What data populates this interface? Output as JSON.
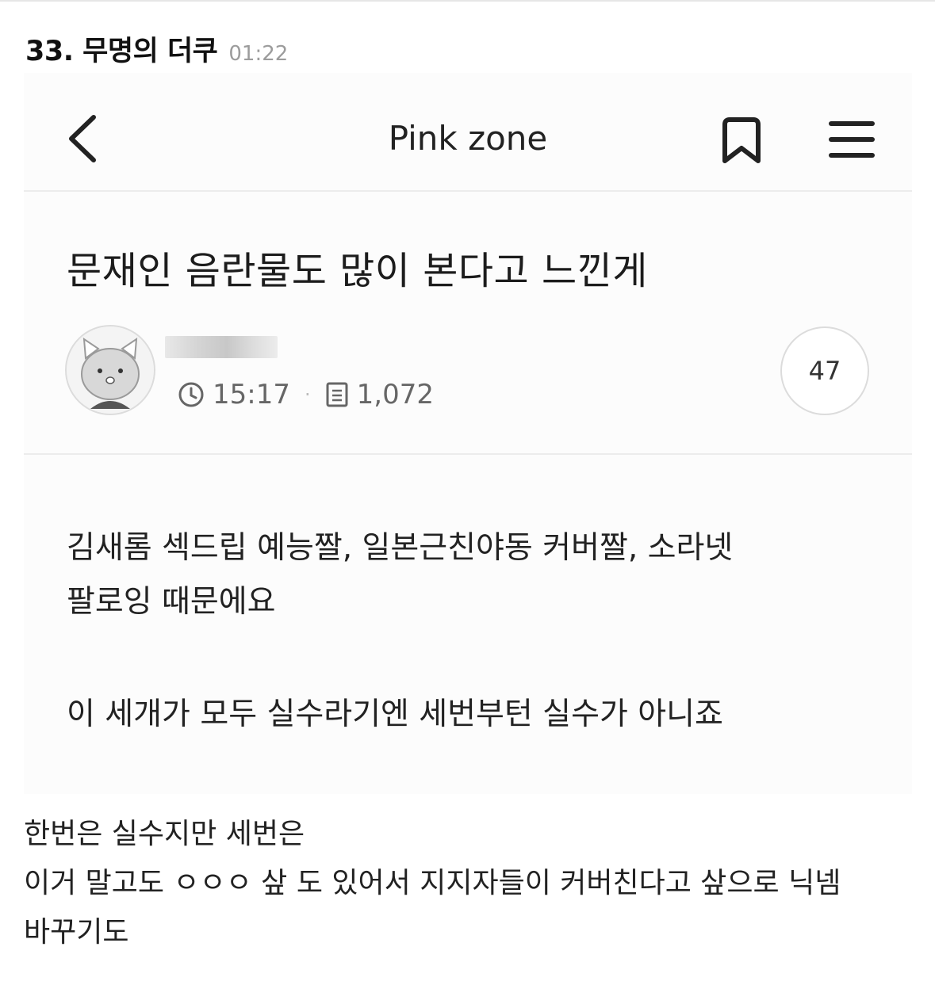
{
  "comment": {
    "number_name": "33. 무명의 더쿠",
    "time": "01:22"
  },
  "screenshot": {
    "nav": {
      "title": "Pink zone",
      "back_icon": "chevron-left-icon",
      "bookmark_icon": "bookmark-icon",
      "menu_icon": "hamburger-menu-icon"
    },
    "post": {
      "title": "문재인 음란물도 많이 본다고 느낀게",
      "time": "15:17",
      "views": "1,072",
      "comment_count": "47",
      "body_line1": "김새롬 섹드립 예능짤, 일본근친야동 커버짤, 소라넷",
      "body_line2": "팔로잉 때문에요",
      "body_line3": "이 세개가 모두 실수라기엔 세번부턴 실수가 아니죠"
    }
  },
  "caption": {
    "line1": "한번은 실수지만 세번은",
    "line2": "이거 말고도 ㅇㅇㅇ 샆 도 있어서 지지자들이 커버친다고 샆으로 닉넴",
    "line3": "바꾸기도"
  }
}
